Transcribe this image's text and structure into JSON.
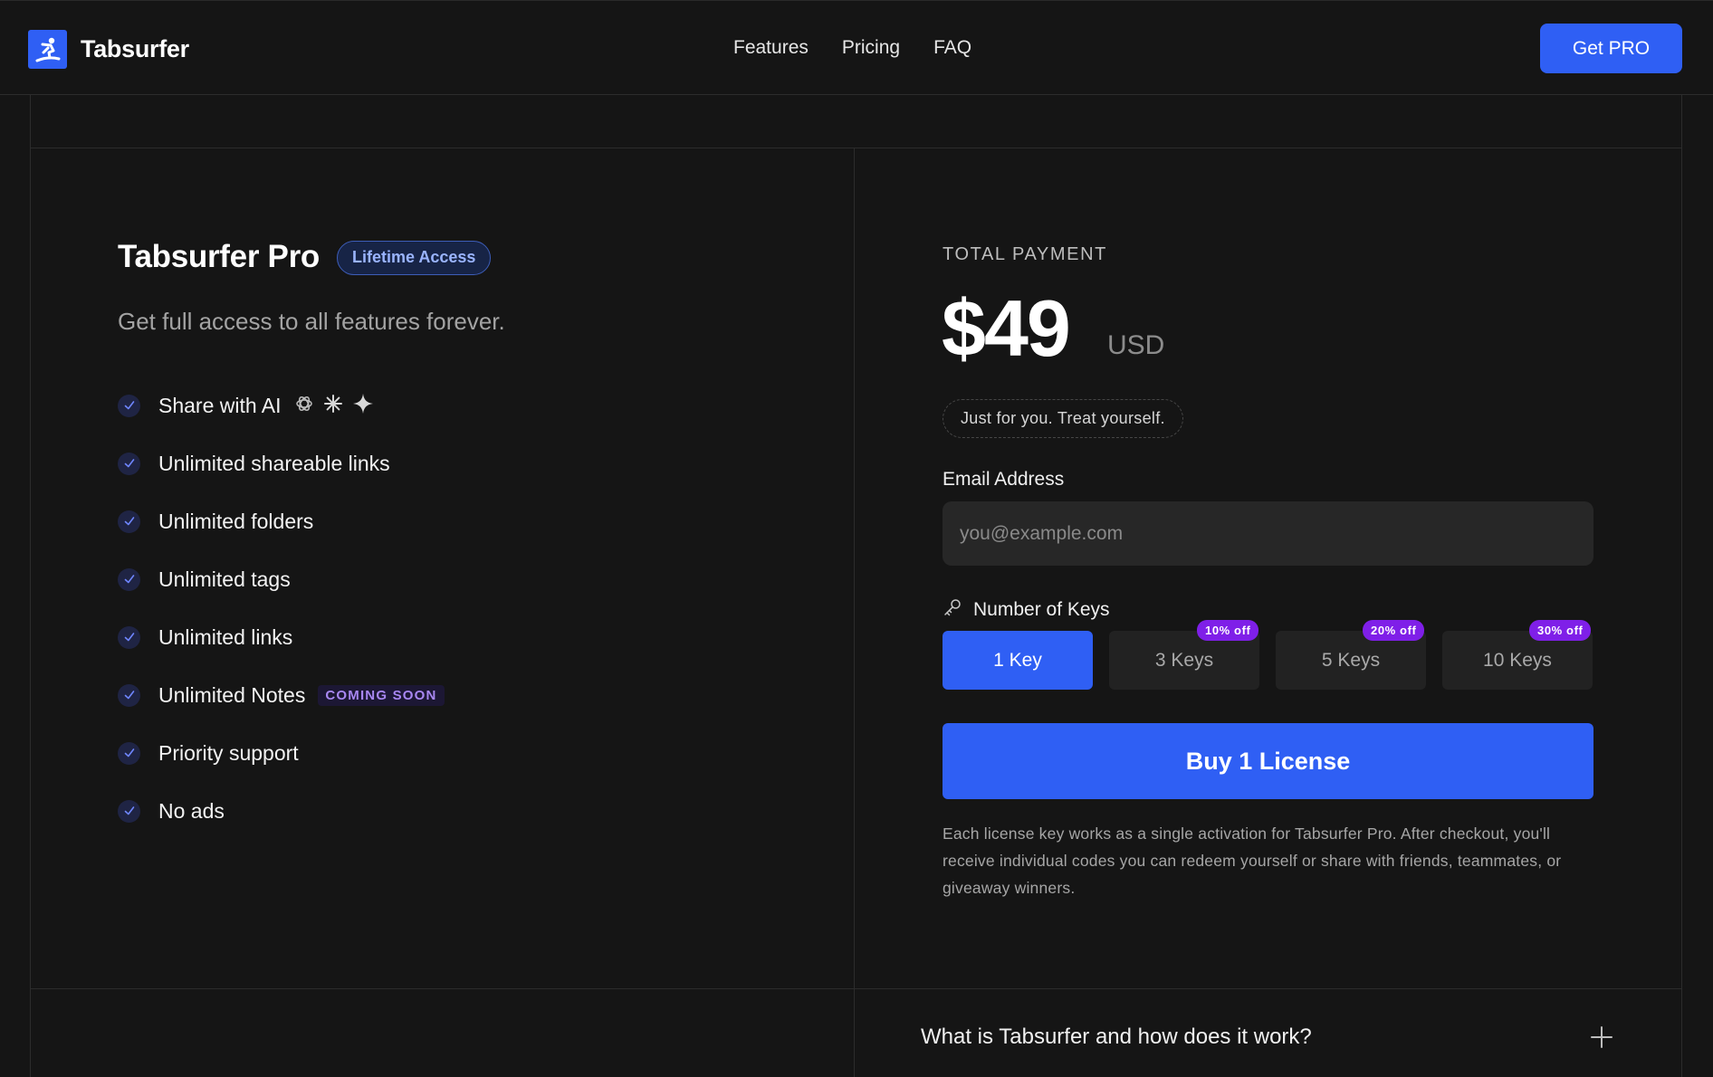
{
  "nav": {
    "brand": "Tabsurfer",
    "links": [
      "Features",
      "Pricing",
      "FAQ"
    ],
    "cta": "Get PRO"
  },
  "plan": {
    "title": "Tabsurfer Pro",
    "badge": "Lifetime Access",
    "subtitle": "Get full access to all features forever.",
    "features": [
      {
        "label": "Share with AI",
        "icons": [
          "openai-icon",
          "claude-icon",
          "gemini-icon"
        ]
      },
      {
        "label": "Unlimited shareable links"
      },
      {
        "label": "Unlimited folders"
      },
      {
        "label": "Unlimited tags"
      },
      {
        "label": "Unlimited links"
      },
      {
        "label": "Unlimited Notes",
        "badge": "COMING SOON"
      },
      {
        "label": "Priority support"
      },
      {
        "label": "No ads"
      }
    ]
  },
  "payment": {
    "total_label": "TOTAL PAYMENT",
    "price": "$49",
    "currency": "USD",
    "tagline": "Just for you. Treat yourself.",
    "email_label": "Email Address",
    "email_value": "",
    "email_placeholder": "you@example.com",
    "keys_label": "Number of Keys",
    "key_options": [
      {
        "label": "1 Key",
        "selected": true
      },
      {
        "label": "3 Keys",
        "discount": "10% off"
      },
      {
        "label": "5 Keys",
        "discount": "20% off"
      },
      {
        "label": "10 Keys",
        "discount": "30% off"
      }
    ],
    "buy_label": "Buy 1 License",
    "fine_print": "Each license key works as a single activation for Tabsurfer Pro. After checkout, you'll receive individual codes you can redeem yourself or share with friends, teammates, or giveaway winners."
  },
  "faq": {
    "items": [
      {
        "question": "What is Tabsurfer and how does it work?"
      }
    ]
  },
  "colors": {
    "background": "#151515",
    "accent": "#2f5ff4",
    "discount_badge": "#7f1fe8",
    "coming_soon": "#a887f2"
  }
}
